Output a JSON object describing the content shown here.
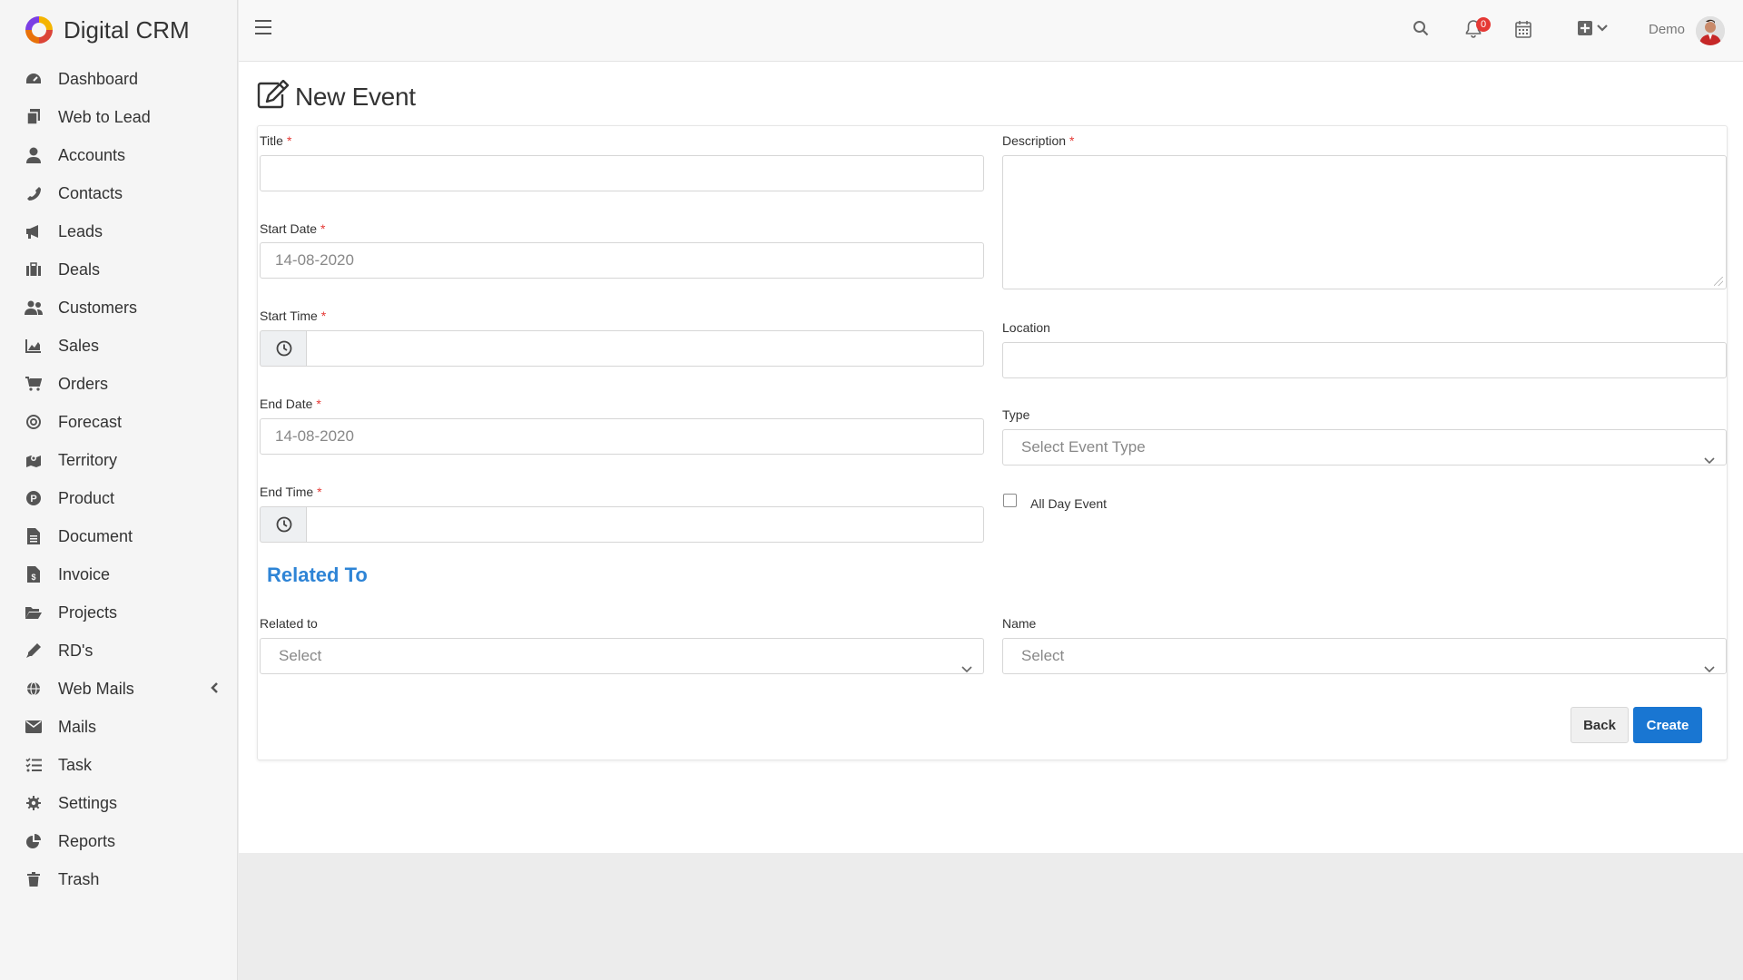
{
  "brand": {
    "name": "Digital CRM"
  },
  "sidebar": {
    "items": [
      {
        "label": "Dashboard"
      },
      {
        "label": "Web to Lead"
      },
      {
        "label": "Accounts"
      },
      {
        "label": "Contacts"
      },
      {
        "label": "Leads"
      },
      {
        "label": "Deals"
      },
      {
        "label": "Customers"
      },
      {
        "label": "Sales"
      },
      {
        "label": "Orders"
      },
      {
        "label": "Forecast"
      },
      {
        "label": "Territory"
      },
      {
        "label": "Product"
      },
      {
        "label": "Document"
      },
      {
        "label": "Invoice"
      },
      {
        "label": "Projects"
      },
      {
        "label": "RD's"
      },
      {
        "label": "Web Mails"
      },
      {
        "label": "Mails"
      },
      {
        "label": "Task"
      },
      {
        "label": "Settings"
      },
      {
        "label": "Reports"
      },
      {
        "label": "Trash"
      }
    ]
  },
  "topbar": {
    "notification_count": "0",
    "user_name": "Demo"
  },
  "page": {
    "title": "New Event"
  },
  "form": {
    "title_label": "Title",
    "title_value": "",
    "start_date_label": "Start Date",
    "start_date_value": "14-08-2020",
    "start_time_label": "Start Time",
    "start_time_value": "",
    "end_date_label": "End Date",
    "end_date_value": "14-08-2020",
    "end_time_label": "End Time",
    "end_time_value": "",
    "description_label": "Description",
    "location_label": "Location",
    "location_value": "",
    "type_label": "Type",
    "type_placeholder": "Select Event Type",
    "all_day_label": "All Day Event",
    "required_mark": "*",
    "related_section_title": "Related To",
    "related_to_label": "Related to",
    "related_to_value": "Select",
    "name_label": "Name",
    "name_value": "Select",
    "back_label": "Back",
    "create_label": "Create"
  },
  "colors": {
    "accent": "#1976d2",
    "required": "#e53935",
    "section_title": "#2e84d6",
    "badge": "#e53935"
  }
}
